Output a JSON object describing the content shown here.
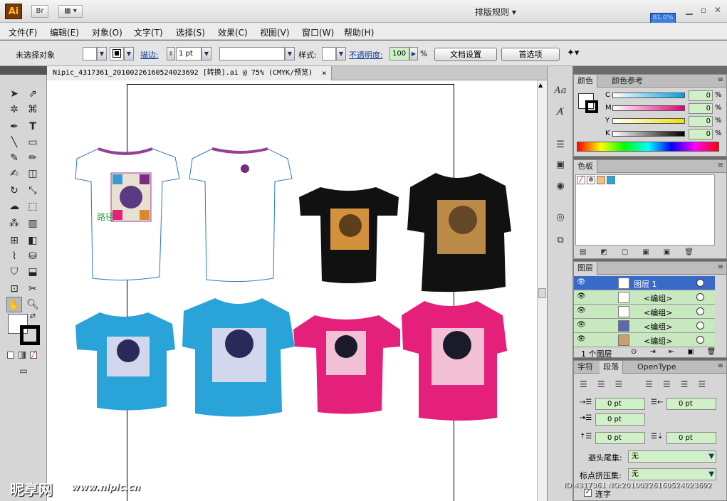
{
  "app": {
    "logo": "Ai",
    "bridge_label": "Br",
    "layout_menu": "排版规则",
    "cpu_meter": "81.0%"
  },
  "menu": [
    "文件(F)",
    "编辑(E)",
    "对象(O)",
    "文字(T)",
    "选择(S)",
    "效果(C)",
    "视图(V)",
    "窗口(W)",
    "帮助(H)"
  ],
  "control": {
    "status": "未选择对象",
    "stroke_label": "描边:",
    "stroke_value": "1 pt",
    "style_label": "样式:",
    "opacity_label": "不透明度:",
    "opacity_value": "100",
    "opacity_unit": "%",
    "doc_setup": "文档设置",
    "preferences": "首选项"
  },
  "document": {
    "tab_title": "Nipic_4317361_20100226160524023692 [转换].ai @ 75% (CMYK/预览)",
    "close": "×",
    "art_text": "路径"
  },
  "color_panel": {
    "tabs": [
      "颜色",
      "颜色参考"
    ],
    "channels": [
      {
        "name": "C",
        "value": "0",
        "unit": "%"
      },
      {
        "name": "M",
        "value": "0",
        "unit": "%"
      },
      {
        "name": "Y",
        "value": "0",
        "unit": "%"
      },
      {
        "name": "K",
        "value": "0",
        "unit": "%"
      }
    ]
  },
  "swatches_panel": {
    "title": "色板"
  },
  "layers_panel": {
    "title": "图层",
    "rows": [
      {
        "name": "图层 1"
      },
      {
        "name": "<编组>"
      },
      {
        "name": "<编组>"
      },
      {
        "name": "<编组>"
      },
      {
        "name": "<编组>"
      }
    ],
    "footer": "1 个图层"
  },
  "paragraph_panel": {
    "tabs": [
      "字符",
      "段落",
      "OpenType"
    ],
    "left_indent": "0 pt",
    "right_indent": "0 pt",
    "first_indent": "0 pt",
    "space_before": "0 pt",
    "space_after": "0 pt",
    "kinsoku_label": "避头尾集:",
    "kinsoku_value": "无",
    "mojikumi_label": "标点挤压集:",
    "mojikumi_value": "无",
    "hyphenate_label": "连字"
  },
  "watermarks": {
    "left_big": "昵享网",
    "left_url": "www.nipic.cn",
    "right_id": "ID:4317361 NO:20100226160524023692"
  },
  "colors": {
    "tshirt_white": "#ffffff",
    "tshirt_black": "#111111",
    "tshirt_blue": "#2aa3d9",
    "tshirt_pink": "#e5207a",
    "collar_purple": "#9b3c96",
    "accent_selected": "#3a6ac8"
  }
}
